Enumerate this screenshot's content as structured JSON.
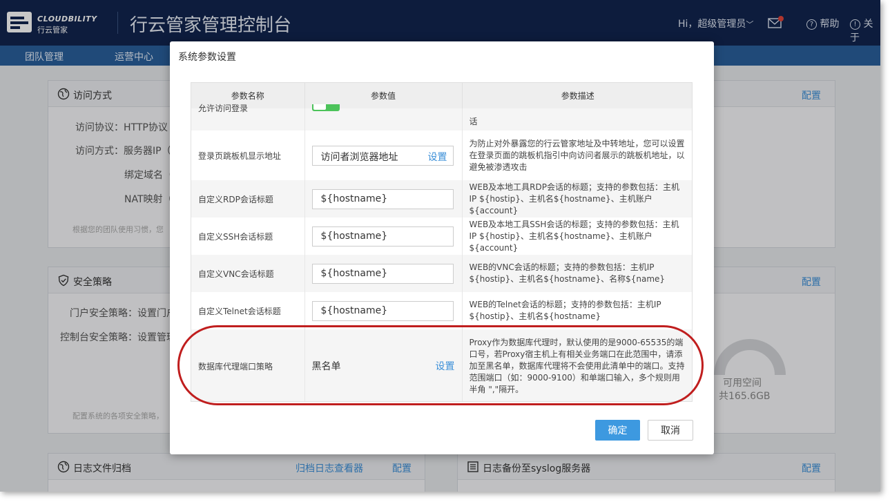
{
  "header": {
    "logo_en": "CLOUDBILITY",
    "logo_cn": "行云管家",
    "app_title": "行云管家管理控制台",
    "greeting": "Hi，超级管理员",
    "help": "帮助",
    "about": "关于"
  },
  "nav": [
    "团队管理",
    "运营中心"
  ],
  "panels": {
    "access": {
      "title": "访问方式",
      "config": "配置",
      "rows": [
        "访问协议：HTTP协议",
        "访问方式：服务器IP（",
        "绑定域名（",
        "NAT映射（"
      ],
      "hint": "根据您的团队使用习惯，您"
    },
    "security": {
      "title": "安全策略",
      "config": "配置",
      "rows": [
        "门户安全策略：设置门户",
        "控制台安全策略：设置管理"
      ],
      "hint": "配置系统的各项安全策略，"
    },
    "log_archive": {
      "title": "日志文件归档",
      "viewer": "归档日志查看器",
      "config": "配置"
    },
    "syslog": {
      "title": "日志备份至syslog服务器",
      "config": "配置"
    },
    "storage": {
      "label": "可用空间",
      "total": "共165.6GB"
    }
  },
  "modal": {
    "title": "系统参数设置",
    "columns": [
      "参数名称",
      "参数值",
      "参数描述"
    ],
    "partial_row": {
      "name": "允许访问登录",
      "desc": "话"
    },
    "rows": [
      {
        "name": "登录页跳板机显示地址",
        "value": "访问者浏览器地址",
        "link": "设置",
        "desc": "为防止对外暴露您的行云管家地址及中转地址，您可以设置在登录页面的跳板机指引中向访问者展示的跳板机地址，以避免被渗透攻击"
      },
      {
        "name": "自定义RDP会话标题",
        "value": "${hostname}",
        "desc": "WEB及本地工具RDP会话的标题；支持的参数包括：主机IP ${hostip}、主机名${hostname}、主机账户${account}"
      },
      {
        "name": "自定义SSH会话标题",
        "value": "${hostname}",
        "desc": "WEB及本地工具SSH会话的标题；支持的参数包括：主机IP ${hostip}、主机名${hostname}、主机账户${account}"
      },
      {
        "name": "自定义VNC会话标题",
        "value": "${hostname}",
        "desc": "WEB的VNC会话的标题；支持的参数包括：主机IP ${hostip}、主机名${hostname}、名称${name}"
      },
      {
        "name": "自定义Telnet会话标题",
        "value": "${hostname}",
        "desc": "WEB的Telnet会话的标题；支持的参数包括：主机IP ${hostip}、主机名${hostname}"
      },
      {
        "name": "数据库代理端口策略",
        "value": "黑名单",
        "link": "设置",
        "desc": "Proxy作为数据库代理时，默认使用的是9000-65535的端口号，若Proxy宿主机上有相关业务端口在此范围中，请添加至黑名单，数据库代理将不会使用此清单中的端口。支持范围端口（如：9000-9100）和单端口输入，多个规则用半角 \",\"隔开。"
      }
    ],
    "ok": "确定",
    "cancel": "取消"
  },
  "colors": {
    "header_bg": "#11254f",
    "nav_bg": "#2a5f9c",
    "accent": "#3d99e0",
    "highlight": "#c01e1e"
  }
}
